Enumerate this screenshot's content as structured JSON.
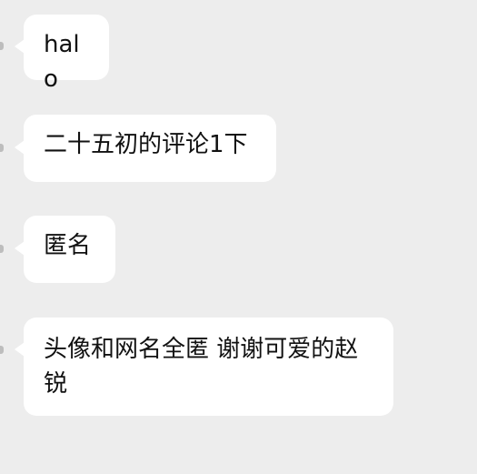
{
  "messages": [
    {
      "text": "halo"
    },
    {
      "text": "二十五初的评论1下"
    },
    {
      "text": "匿名"
    },
    {
      "text": "头像和网名全匿 谢谢可爱的赵锐"
    }
  ]
}
